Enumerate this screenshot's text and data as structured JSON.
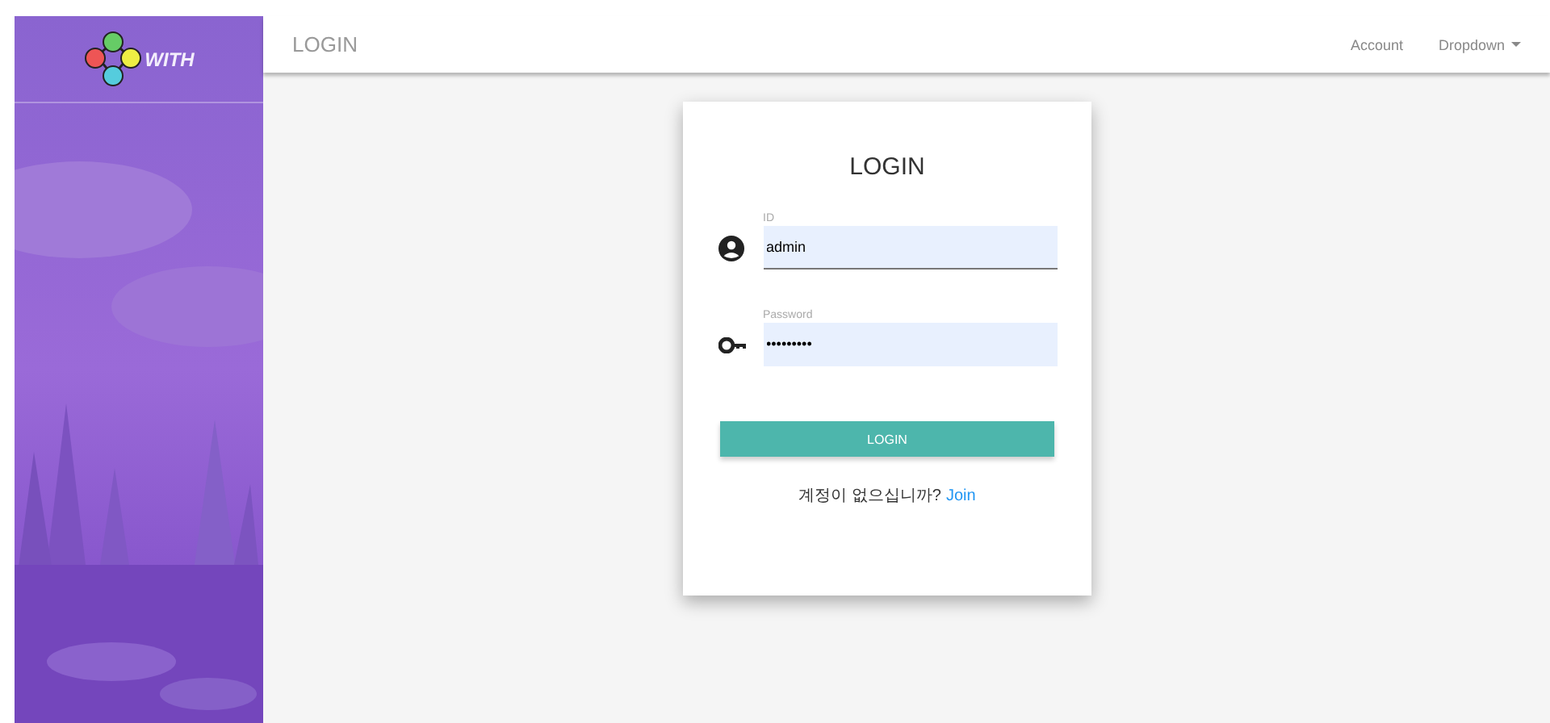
{
  "sidebar": {
    "logo_text": "WITH"
  },
  "navbar": {
    "title": "LOGIN",
    "links": [
      {
        "label": "Account",
        "kind": "link"
      },
      {
        "label": "Dropdown",
        "kind": "dropdown"
      }
    ]
  },
  "login_card": {
    "title": "LOGIN",
    "fields": [
      {
        "kind": "user",
        "label": "ID",
        "value": "admin",
        "focused": true
      },
      {
        "kind": "key",
        "label": "Password",
        "value": "•••••••••",
        "focused": false
      }
    ],
    "button": "LOGIN",
    "prompt": "계정이 없으십니까?",
    "join_link": "Join"
  }
}
